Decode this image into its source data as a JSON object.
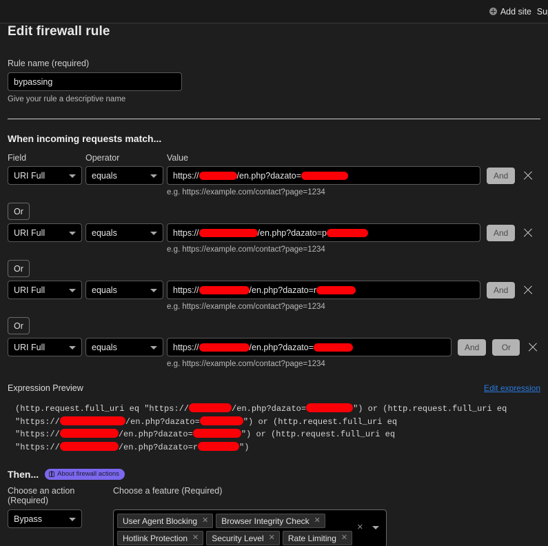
{
  "topbar": {
    "add_site": "Add site",
    "support": "Sup",
    "add_site_icon": "plus-circle-icon"
  },
  "page": {
    "title": "Edit firewall rule"
  },
  "rule_name": {
    "label": "Rule name (required)",
    "value": "bypassing",
    "helper": "Give your rule a descriptive name"
  },
  "match_section": {
    "title": "When incoming requests match...",
    "columns": {
      "field": "Field",
      "operator": "Operator",
      "value": "Value"
    },
    "value_helper": "e.g. https://example.com/contact?page=1234",
    "and_label": "And",
    "or_label": "Or",
    "rows": [
      {
        "field": "URI Full",
        "operator": "equals",
        "value_prefix": "https://",
        "redact1_width": 55,
        "value_mid": "/en.php?dazato=",
        "redact2_width": 68,
        "buttons": [
          "And"
        ]
      },
      {
        "field": "URI Full",
        "operator": "equals",
        "value_prefix": "https://",
        "redact1_width": 85,
        "value_mid": "/en.php?dazato=p",
        "redact2_width": 60,
        "buttons": [
          "And"
        ]
      },
      {
        "field": "URI Full",
        "operator": "equals",
        "value_prefix": "https://",
        "redact1_width": 73,
        "value_mid": "/en.php?dazato=r",
        "redact2_width": 57,
        "buttons": [
          "And"
        ]
      },
      {
        "field": "URI Full",
        "operator": "equals",
        "value_prefix": "https://",
        "redact1_width": 73,
        "value_mid": "/en.php?dazato=",
        "redact2_width": 57,
        "buttons": [
          "And",
          "Or"
        ]
      }
    ]
  },
  "expression": {
    "title": "Expression Preview",
    "edit_link": "Edit expression",
    "lines": [
      {
        "parts": [
          {
            "t": "(http.request.full_uri eq \"https://"
          },
          {
            "r": 62
          },
          {
            "t": "/en.php?dazato="
          },
          {
            "r": 68
          },
          {
            "t": "\") or (http.request.full_uri eq"
          }
        ]
      },
      {
        "parts": [
          {
            "t": "\"https://"
          },
          {
            "r": 95
          },
          {
            "t": "/en.php?dazato="
          },
          {
            "r": 63
          },
          {
            "t": "\") or (http.request.full_uri eq"
          }
        ]
      },
      {
        "parts": [
          {
            "t": "\"https://"
          },
          {
            "r": 85
          },
          {
            "t": "/en.php?dazato="
          },
          {
            "r": 70
          },
          {
            "t": "\") or (http.request.full_uri eq"
          }
        ]
      },
      {
        "parts": [
          {
            "t": "\"https://"
          },
          {
            "r": 85
          },
          {
            "t": "/en.php?dazato=r"
          },
          {
            "r": 60
          },
          {
            "t": "\")"
          }
        ]
      }
    ]
  },
  "then_section": {
    "title": "Then...",
    "badge": "About firewall actions",
    "badge_icon": "book-icon",
    "action_label": "Choose an action (Required)",
    "feature_label": "Choose a feature (Required)",
    "action_value": "Bypass",
    "features": [
      "User Agent Blocking",
      "Browser Integrity Check",
      "Hotlink Protection",
      "Security Level",
      "Rate Limiting"
    ],
    "clear_icon": "clear-all-icon",
    "caret_icon": "chevron-down-icon"
  }
}
